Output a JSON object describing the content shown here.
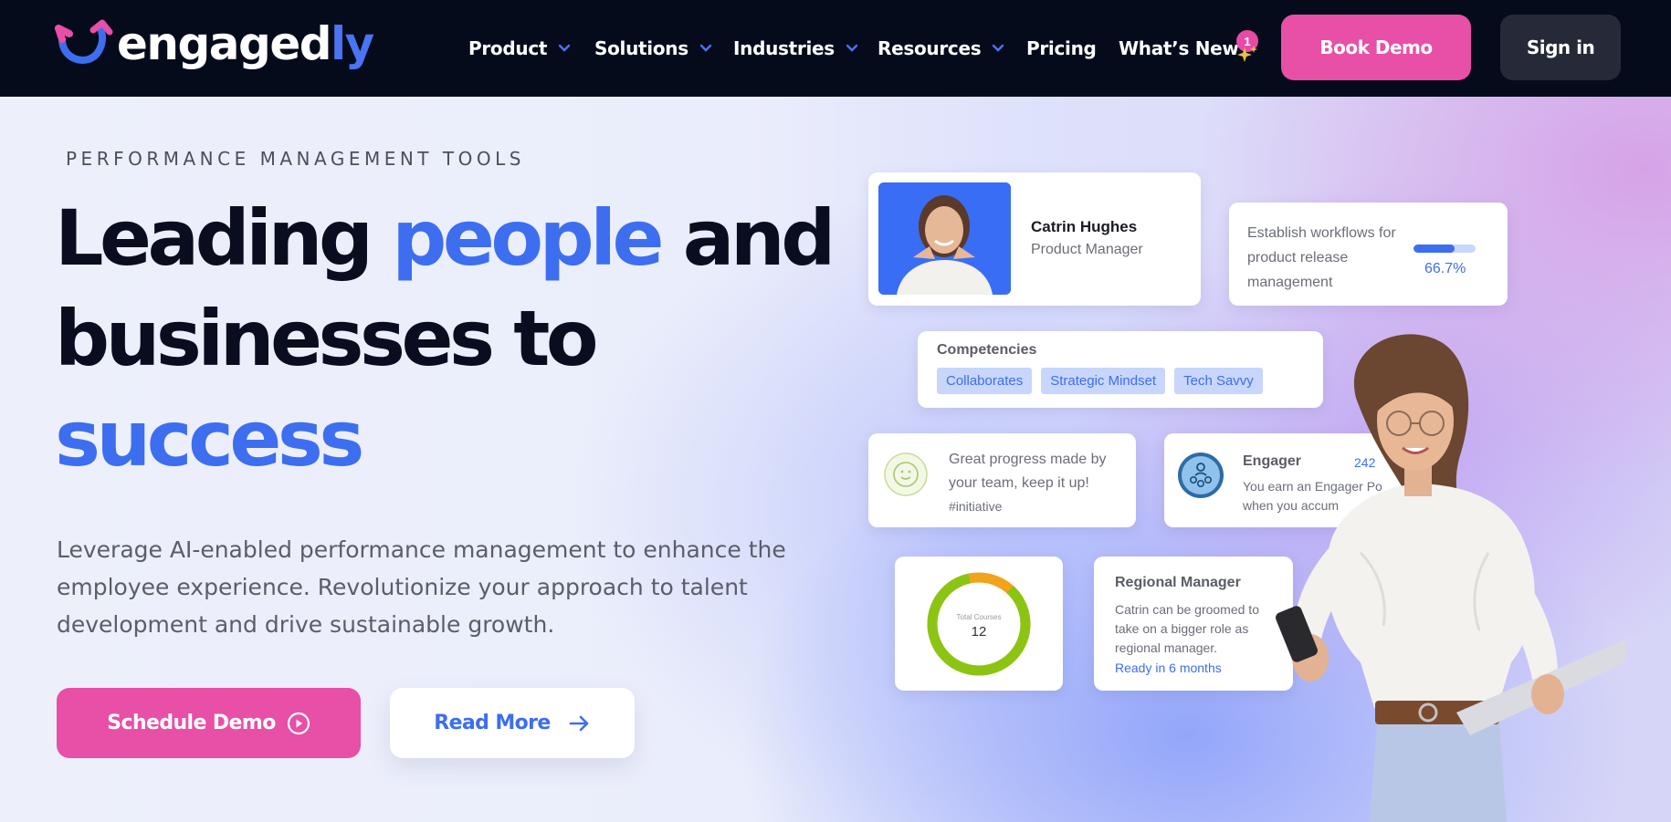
{
  "nav": {
    "logo_main": "engaged",
    "logo_accent": "ly",
    "items": [
      {
        "label": "Product",
        "has_dropdown": true
      },
      {
        "label": "Solutions",
        "has_dropdown": true
      },
      {
        "label": "Industries",
        "has_dropdown": true
      },
      {
        "label": "Resources",
        "has_dropdown": true
      },
      {
        "label": "Pricing",
        "has_dropdown": false
      },
      {
        "label": "What’s New",
        "has_dropdown": false
      }
    ],
    "whats_new_badge": "1",
    "book_demo": "Book Demo",
    "sign_in": "Sign in"
  },
  "hero": {
    "eyebrow": "PERFORMANCE MANAGEMENT TOOLS",
    "headline_part1": "Leading ",
    "headline_highlight1": "people",
    "headline_part2": " and businesses to ",
    "headline_highlight2": "success",
    "subtext": "Leverage AI-enabled performance management to enhance the employee experience. Revolutionize your approach to talent development and drive sustainable growth.",
    "schedule_demo": "Schedule Demo",
    "read_more": "Read More"
  },
  "cards": {
    "profile": {
      "name": "Catrin Hughes",
      "role": "Product Manager"
    },
    "workflow": {
      "text": "Establish workflows for product release management",
      "progress_label": "66.7%",
      "progress_fraction": 0.667
    },
    "competencies": {
      "title": "Competencies",
      "tags": [
        "Collaborates",
        "Strategic Mindset",
        "Tech Savvy"
      ]
    },
    "progress": {
      "text": "Great progress made by your team, keep it up!",
      "tag": "#initiative"
    },
    "engager": {
      "title": "Engager",
      "points": "242",
      "text_line1": "You earn an Engager Po",
      "text_line2": "when you accum"
    },
    "courses": {
      "label": "Total Courses",
      "value": "12",
      "ring_fraction_green": 0.85
    },
    "regional": {
      "title": "Regional Manager",
      "text": "Catrin can be groomed to take on a bigger role as regional manager.",
      "ready": "Ready in 6 months"
    }
  },
  "colors": {
    "nav_bg": "#060b1c",
    "brand_pink": "#e84fa7",
    "brand_blue": "#3d6ef0",
    "signin_bg": "#262a38"
  }
}
